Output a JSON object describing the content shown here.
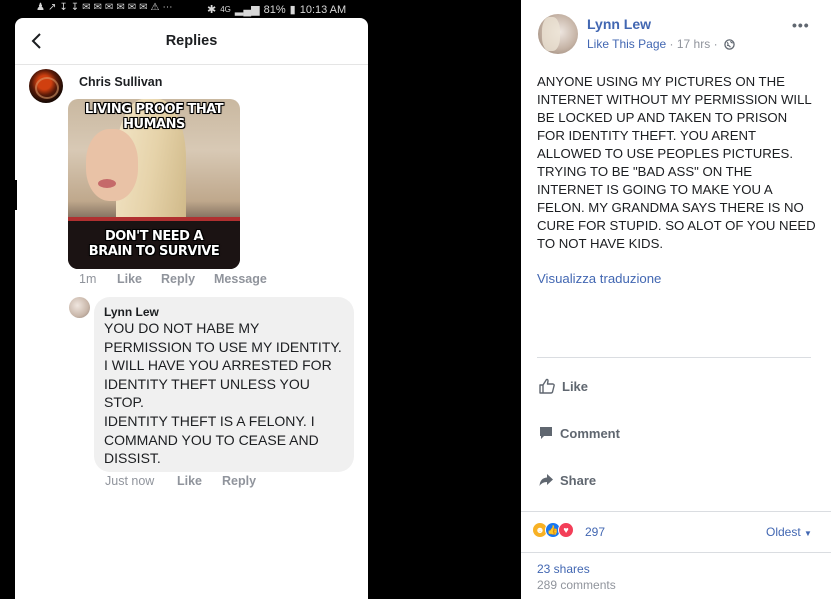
{
  "status_bar": {
    "battery": "81%",
    "time": "10:13 AM",
    "network": "4G"
  },
  "replies_panel": {
    "title": "Replies",
    "comment": {
      "author": "Chris Sullivan",
      "meme_top_text": "LIVING PROOF THAT HUMANS",
      "meme_bottom_text": "DON'T NEED A\nBRAIN TO SURVIVE",
      "time": "1m",
      "like_label": "Like",
      "reply_label": "Reply",
      "message_label": "Message"
    },
    "reply": {
      "author": "Lynn Lew",
      "text": "YOU DO NOT HABE MY PERMISSION TO USE MY IDENTITY. I WILL HAVE YOU ARRESTED FOR IDENTITY THEFT UNLESS YOU STOP.\nIDENTITY THEFT IS A FELONY. I COMMAND YOU TO CEASE AND DISSIST.",
      "time": "Just now",
      "like_label": "Like",
      "reply_label": "Reply"
    }
  },
  "post": {
    "author": "Lynn Lew",
    "like_page_label": "Like This Page",
    "time": "17 hrs",
    "text": "ANYONE USING MY PICTURES ON THE INTERNET WITHOUT MY PERMISSION WILL BE LOCKED UP AND TAKEN TO PRISON FOR IDENTITY THEFT. YOU ARENT ALLOWED TO USE PEOPLES PICTURES. TRYING TO BE \"BAD ASS\" ON THE INTERNET IS GOING TO MAKE YOU A FELON. MY GRANDMA SAYS THERE IS NO CURE FOR STUPID. SO ALOT OF YOU NEED TO NOT HAVE KIDS.",
    "translate_label": "Visualizza traduzione",
    "like_label": "Like",
    "comment_label": "Comment",
    "share_label": "Share",
    "reactions_count": "297",
    "sort_label": "Oldest",
    "shares_label": "23 shares",
    "comments_label": "289 comments",
    "colors": {
      "link": "#4267b2",
      "muted": "#90949c"
    }
  }
}
